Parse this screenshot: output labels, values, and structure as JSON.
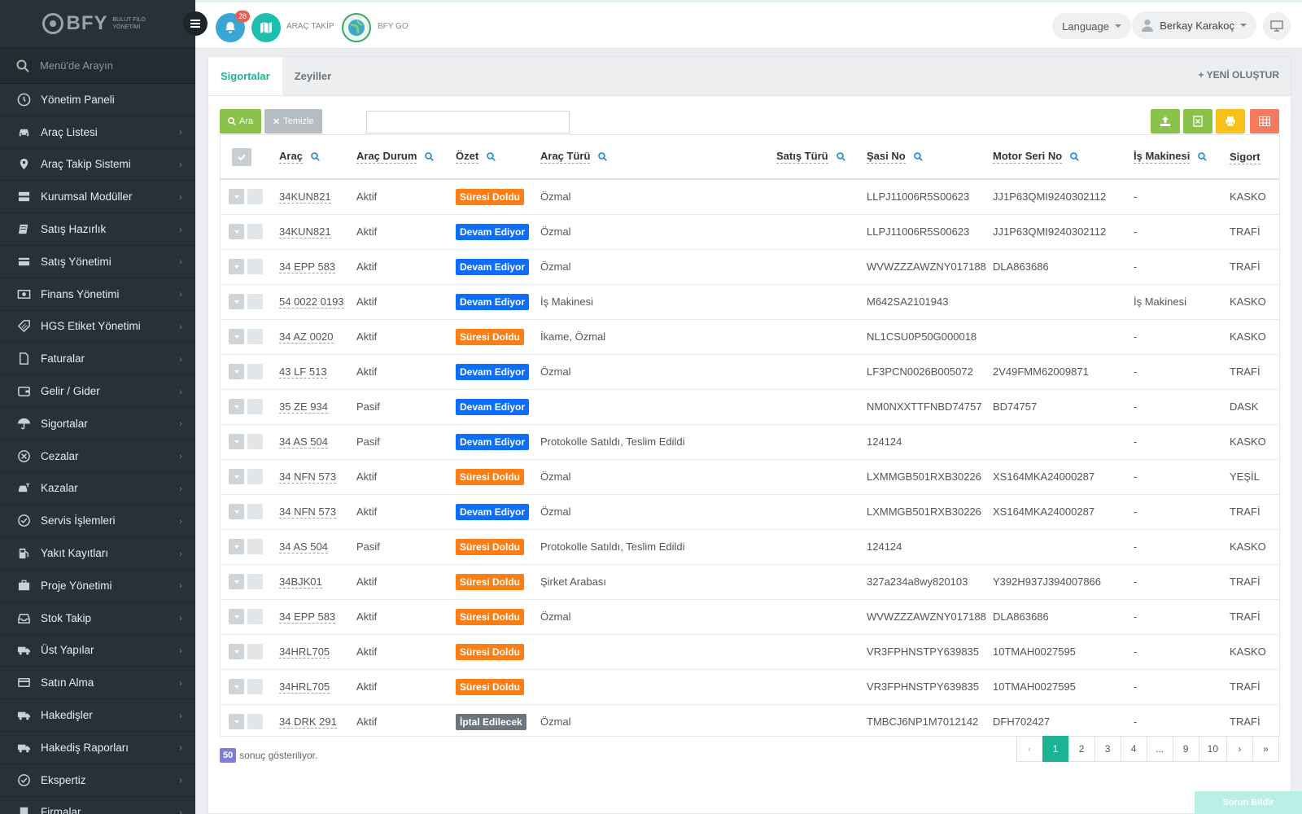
{
  "brand": {
    "name": "BFY",
    "subtitle": "BULUT FİLO YÖNETİMİ"
  },
  "sidebar": {
    "search_placeholder": "Menü'de Arayın",
    "items": [
      {
        "label": "Yönetim Paneli",
        "icon": "dashboard-icon",
        "chevron": false
      },
      {
        "label": "Araç Listesi",
        "icon": "car-icon",
        "chevron": true
      },
      {
        "label": "Araç Takip Sistemi",
        "icon": "map-pin-icon",
        "chevron": true
      },
      {
        "label": "Kurumsal Modüller",
        "icon": "server-icon",
        "chevron": true
      },
      {
        "label": "Satış Hazırlık",
        "icon": "book-icon",
        "chevron": true
      },
      {
        "label": "Satış Yönetimi",
        "icon": "credit-card-icon",
        "chevron": true
      },
      {
        "label": "Finans Yönetimi",
        "icon": "money-icon",
        "chevron": true
      },
      {
        "label": "HGS Etiket Yönetimi",
        "icon": "tag-icon",
        "chevron": true
      },
      {
        "label": "Faturalar",
        "icon": "file-icon",
        "chevron": true
      },
      {
        "label": "Gelir / Gider",
        "icon": "wallet-icon",
        "chevron": true
      },
      {
        "label": "Sigortalar",
        "icon": "umbrella-icon",
        "chevron": true
      },
      {
        "label": "Cezalar",
        "icon": "x-circle-icon",
        "chevron": true
      },
      {
        "label": "Kazalar",
        "icon": "crash-icon",
        "chevron": true
      },
      {
        "label": "Servis İşlemleri",
        "icon": "check-circle-icon",
        "chevron": true
      },
      {
        "label": "Yakıt Kayıtları",
        "icon": "fuel-icon",
        "chevron": true
      },
      {
        "label": "Proje Yönetimi",
        "icon": "briefcase-icon",
        "chevron": true
      },
      {
        "label": "Stok Takip",
        "icon": "inbox-icon",
        "chevron": true
      },
      {
        "label": "Üst Yapılar",
        "icon": "truck-icon",
        "chevron": true
      },
      {
        "label": "Satın Alma",
        "icon": "card-icon",
        "chevron": true
      },
      {
        "label": "Hakedişler",
        "icon": "truck-icon",
        "chevron": true
      },
      {
        "label": "Hakediş Raporları",
        "icon": "truck-icon",
        "chevron": true
      },
      {
        "label": "Ekspertiz",
        "icon": "check-circle-icon",
        "chevron": true
      },
      {
        "label": "Firmalar",
        "icon": "building-icon",
        "chevron": true
      }
    ]
  },
  "topbar": {
    "notification_count": "28",
    "arac_takip": "ARAÇ TAKİP",
    "bfy_go": "BFY GO",
    "language": "Language",
    "user": "Berkay Karakoç"
  },
  "tabs": [
    {
      "label": "Sigortalar",
      "active": true
    },
    {
      "label": "Zeyiller",
      "active": false
    }
  ],
  "new_button": "YENİ OLUŞTUR",
  "toolbar": {
    "search_label": "Ara",
    "clear_label": "Temizle"
  },
  "colors": {
    "accent": "#1ab394",
    "expired": "#fd7e14",
    "ongoing": "#0d6efd",
    "cancel": "#6c757d",
    "sidebar": "#263238"
  },
  "table": {
    "columns": [
      "Araç",
      "Araç Durum",
      "Özet",
      "Araç Türü",
      "Satış Türü",
      "Şasi No",
      "Motor Seri No",
      "İş Makinesi",
      "Sigort"
    ],
    "rows": [
      [
        "34KUN821",
        "Aktif",
        "Süresi Doldu",
        "Özmal",
        "",
        "LLPJ11006R5S00623",
        "JJ1P63QMI9240302112",
        "-",
        "KASKO"
      ],
      [
        "34KUN821",
        "Aktif",
        "Devam Ediyor",
        "Özmal",
        "",
        "LLPJ11006R5S00623",
        "JJ1P63QMI9240302112",
        "-",
        "TRAFİ"
      ],
      [
        "34 EPP 583",
        "Aktif",
        "Devam Ediyor",
        "Özmal",
        "",
        "WVWZZZAWZNY017188",
        "DLA863686",
        "-",
        "TRAFİ"
      ],
      [
        "54 0022 0193",
        "Aktif",
        "Devam Ediyor",
        "İş Makinesi",
        "",
        "M642SA2101943",
        "",
        "İş Makinesi",
        "KASKO"
      ],
      [
        "34 AZ 0020",
        "Aktif",
        "Süresi Doldu",
        "İkame, Özmal",
        "",
        "NL1CSU0P50G000018",
        "",
        "-",
        "KASKO"
      ],
      [
        "43 LF 513",
        "Aktif",
        "Devam Ediyor",
        "Özmal",
        "",
        "LF3PCN0026B005072",
        "2V49FMM62009871",
        "-",
        "TRAFİ"
      ],
      [
        "35 ZE 934",
        "Pasif",
        "Devam Ediyor",
        "",
        "",
        "NM0NXXTTFNBD74757",
        "BD74757",
        "-",
        "DASK"
      ],
      [
        "34 AS 504",
        "Pasif",
        "Devam Ediyor",
        "Protokolle Satıldı, Teslim Edildi",
        "",
        "124124",
        "",
        "-",
        "KASKO"
      ],
      [
        "34 NFN 573",
        "Aktif",
        "Süresi Doldu",
        "Özmal",
        "",
        "LXMMGB501RXB30226",
        "XS164MKA24000287",
        "-",
        "YEŞİL"
      ],
      [
        "34 NFN 573",
        "Aktif",
        "Devam Ediyor",
        "Özmal",
        "",
        "LXMMGB501RXB30226",
        "XS164MKA24000287",
        "-",
        "TRAFİ"
      ],
      [
        "34 AS 504",
        "Pasif",
        "Süresi Doldu",
        "Protokolle Satıldı, Teslim Edildi",
        "",
        "124124",
        "",
        "-",
        "KASKO"
      ],
      [
        "34BJK01",
        "Aktif",
        "Süresi Doldu",
        "Şirket Arabası",
        "",
        "327a234a8wy820103",
        "Y392H937J394007866",
        "-",
        "TRAFİ"
      ],
      [
        "34 EPP 583",
        "Aktif",
        "Süresi Doldu",
        "Özmal",
        "",
        "WVWZZZAWZNY017188",
        "DLA863686",
        "-",
        "TRAFİ"
      ],
      [
        "34HRL705",
        "Aktif",
        "Süresi Doldu",
        "",
        "",
        "VR3FPHNSTPY639835",
        "10TMAH0027595",
        "-",
        "KASKO"
      ],
      [
        "34HRL705",
        "Aktif",
        "Süresi Doldu",
        "",
        "",
        "VR3FPHNSTPY639835",
        "10TMAH0027595",
        "-",
        "TRAFİ"
      ],
      [
        "34 DRK 291",
        "Aktif",
        "İptal Edilecek",
        "Özmal",
        "",
        "TMBCJ6NP1M7012142",
        "DFH702427",
        "-",
        "TRAFİ"
      ]
    ]
  },
  "footer": {
    "count": "50",
    "text": "sonuç gösteriliyor."
  },
  "pagination": [
    "‹",
    "1",
    "2",
    "3",
    "4",
    "...",
    "9",
    "10",
    "›",
    "»"
  ],
  "report_button": "Sorun Bildir"
}
